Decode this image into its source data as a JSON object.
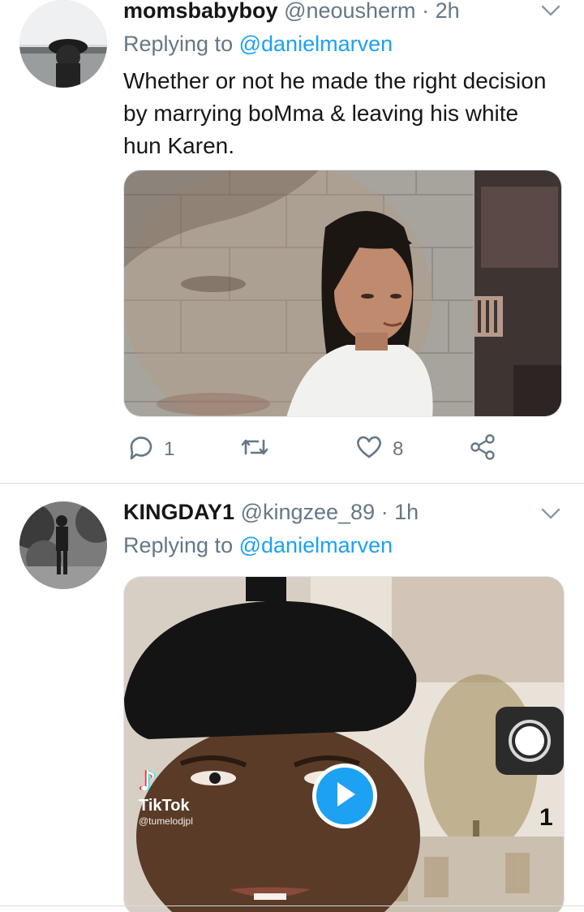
{
  "tweets": [
    {
      "name": "momsbabyboy",
      "handle": "@neousherm",
      "separator": "·",
      "time": "2h",
      "replying_prefix": "Replying to",
      "replying_to": "@danielmarven",
      "text": "Whether or not he made the right decision by marrying boMma & leaving his white hun Karen.",
      "reply_count": "1",
      "like_count": "8",
      "icons": [
        "reply-icon",
        "retweet-icon",
        "like-icon",
        "share-icon",
        "chevron-down-icon"
      ]
    },
    {
      "name": "KINGDAY1",
      "handle": "@kingzee_89",
      "separator": "·",
      "time": "1h",
      "replying_prefix": "Replying to",
      "replying_to": "@danielmarven",
      "video_watermark_app": "TikTok",
      "video_watermark_user": "@tumelodjpl",
      "video_overlay_digit": "1",
      "icons": [
        "chevron-down-icon",
        "play-icon",
        "tiktok-logo-icon",
        "record-button-icon"
      ]
    }
  ],
  "colors": {
    "accent": "#1da1f2",
    "secondary_text": "#657786",
    "primary_text": "#14171a",
    "divider": "#d6dde3"
  }
}
